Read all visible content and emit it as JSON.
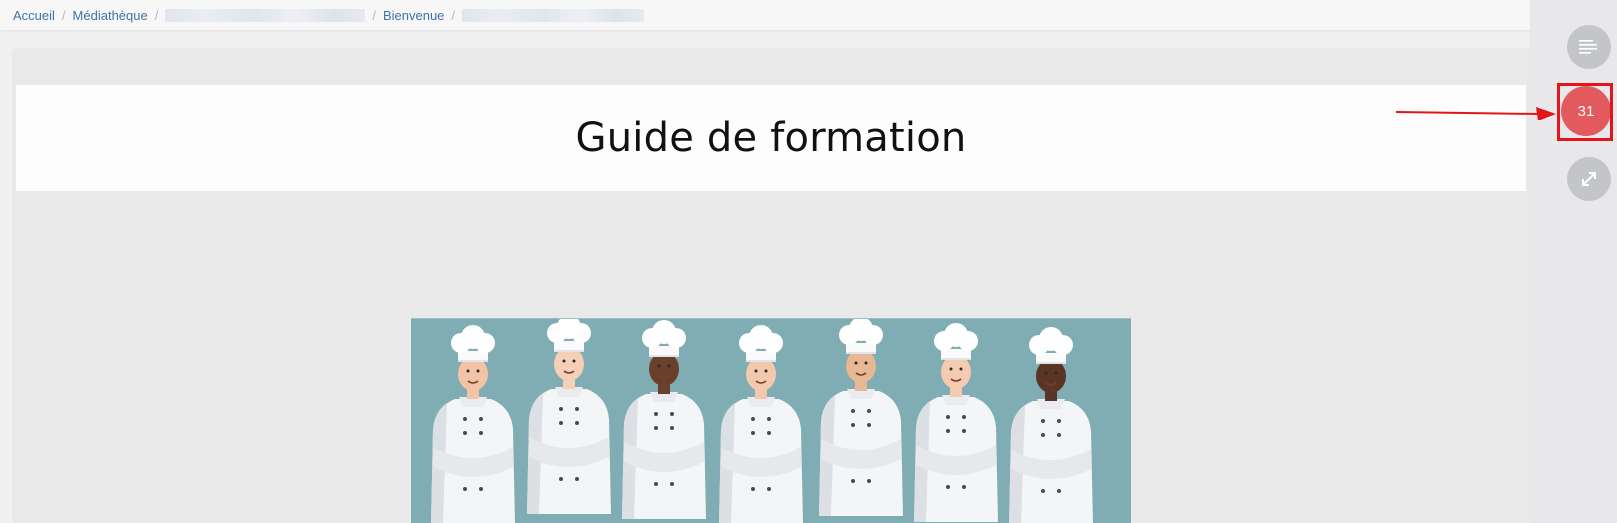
{
  "breadcrumb": {
    "items": [
      {
        "label": "Accueil",
        "blurred": false
      },
      {
        "label": "Médiathèque",
        "blurred": false
      },
      {
        "label": "",
        "blurred": true,
        "blur_width": 207
      },
      {
        "label": "Bienvenue",
        "blurred": false
      },
      {
        "label": "",
        "blurred": true,
        "blur_width": 188
      }
    ],
    "separator": "/"
  },
  "document": {
    "title": "Guide de formation",
    "image_icon": "chef-team-illustration"
  },
  "rail": {
    "toc_icon": "list-icon",
    "notification_count": "31",
    "expand_icon": "expand-icon"
  },
  "annotation": {
    "color": "#e3141b"
  },
  "colors": {
    "link": "#3f73a8",
    "notification": "#e35a5e",
    "image_bg": "#7fadb3"
  }
}
